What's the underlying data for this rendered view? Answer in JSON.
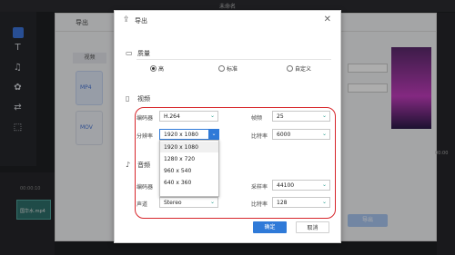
{
  "app": {
    "title": "未命名"
  },
  "background": {
    "window_title": "导出",
    "tab_label": "视频",
    "file_mp4": "MP4",
    "file_mov": "MOV",
    "export_button": "导出",
    "clip_label": "国华水.mp4",
    "timeline_time": "00:00:10",
    "right_time": "00:00"
  },
  "dialog": {
    "title": "导出",
    "quality": {
      "title": "质量",
      "options": [
        "高",
        "标准",
        "自定义"
      ],
      "selected": "高"
    },
    "video": {
      "title": "视频",
      "encoder_label": "编码器",
      "encoder_value": "H.264",
      "framerate_label": "帧频",
      "framerate_value": "25",
      "resolution_label": "分辨率",
      "resolution_value": "1920 x 1080",
      "bitrate_label": "比特率",
      "bitrate_value": "6000",
      "resolution_options": [
        "1920 x 1080",
        "1280 x 720",
        "960 x 540",
        "640 x 360"
      ]
    },
    "audio": {
      "title": "音频",
      "encoder_label": "编码器",
      "samplerate_label": "采样率",
      "samplerate_value": "44100",
      "channel_label": "声道",
      "channel_value": "Stereo",
      "bitrate_label": "比特率",
      "bitrate_value": "128"
    },
    "ok_button": "确定",
    "cancel_button": "取消"
  },
  "colors": {
    "accent": "#2f7ad8",
    "highlight_frame": "#d7262b"
  }
}
